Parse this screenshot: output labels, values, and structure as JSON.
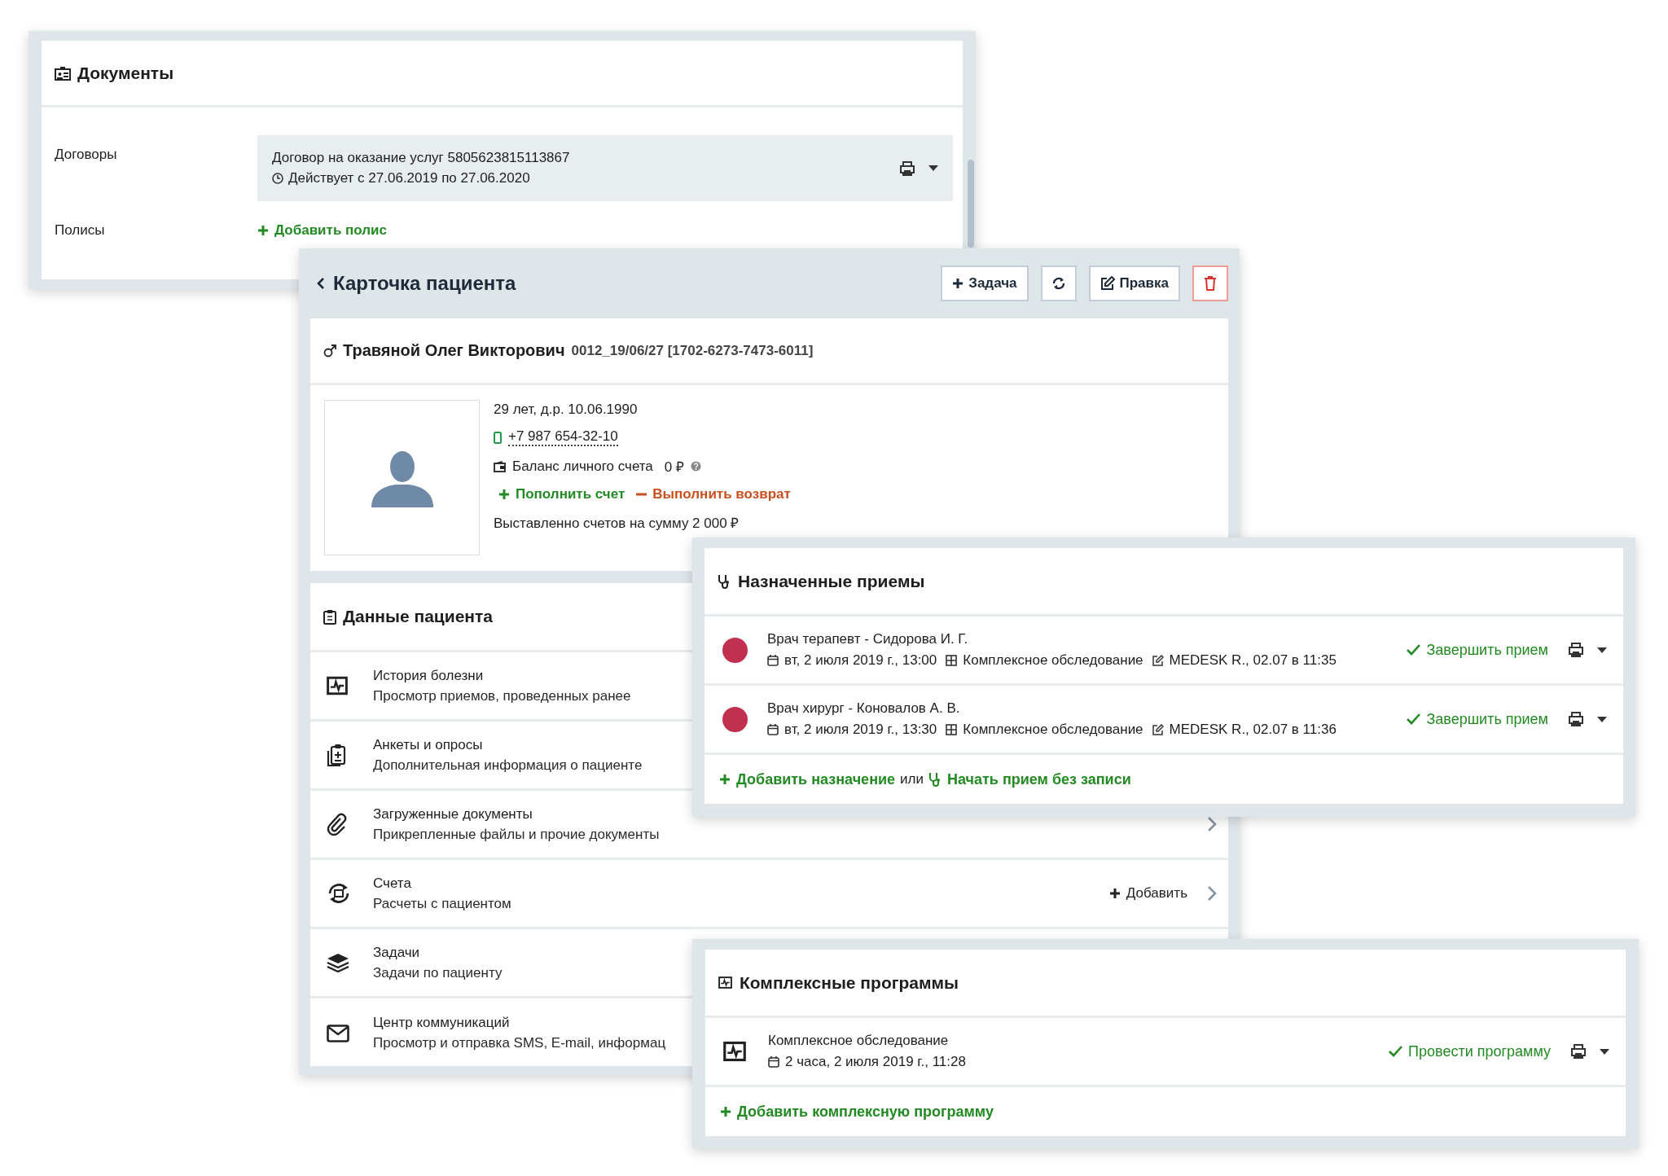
{
  "documents_panel": {
    "title": "Документы",
    "rows": [
      {
        "kind": "contract",
        "label": "Договоры",
        "contract_title": "Договор на оказание услуг 5805623815113867",
        "validity": "Действует с 27.06.2019 по 27.06.2020"
      },
      {
        "kind": "add",
        "label": "Полисы",
        "link": "Добавить полис"
      }
    ]
  },
  "patient_card": {
    "title": "Карточка пациента",
    "buttons": [
      {
        "kind": "task",
        "label": "Задача"
      },
      {
        "kind": "refresh"
      },
      {
        "kind": "edit",
        "label": "Правка"
      },
      {
        "kind": "delete"
      }
    ],
    "patient": {
      "name": "Травяной Олег Викторович",
      "record_id": "0012_19/06/27 [1702-6273-7473-6011]",
      "age_birth": "29 лет, д.р. 10.06.1990",
      "phone": "+7 987 654-32-10",
      "balance_label": "Баланс личного счета",
      "balance": "0 ₽",
      "top_up": "Пополнить счет",
      "refund": "Выполнить возврат",
      "invoiced": "Выставленно счетов на сумму 2 000 ₽"
    },
    "data_section": {
      "title": "Данные пациента",
      "items": [
        {
          "kind": "history",
          "title": "История болезни",
          "subtitle": "Просмотр приемов, проведенных ранее",
          "chevron": false
        },
        {
          "kind": "survey",
          "title": "Анкеты и опросы",
          "subtitle": "Дополнительная информация о пациенте",
          "chevron": false
        },
        {
          "kind": "documents",
          "title": "Загруженные документы",
          "subtitle": "Прикрепленные файлы и прочие документы",
          "chevron": true
        },
        {
          "kind": "invoices",
          "title": "Счета",
          "subtitle": "Расчеты с пациентом",
          "action": "Добавить",
          "chevron": true
        },
        {
          "kind": "tasks",
          "title": "Задачи",
          "subtitle": "Задачи по пациенту",
          "chevron": false
        },
        {
          "kind": "messages",
          "title": "Центр коммуникаций",
          "subtitle": "Просмотр и отправка SMS, E-mail, информац",
          "chevron": false
        }
      ]
    }
  },
  "appointments": {
    "title": "Назначенные приемы",
    "rows": [
      {
        "doctor": "Врач терапевт - Сидорова И. Г.",
        "date": "вт, 2 июля 2019 г., 13:00",
        "program": "Комплексное обследование",
        "edited": "MEDESK R., 02.07 в 11:35",
        "action": "Завершить прием"
      },
      {
        "doctor": "Врач хирург - Коновалов А. В.",
        "date": "вт, 2 июля 2019 г., 13:30",
        "program": "Комплексное обследование",
        "edited": "MEDESK R., 02.07 в 11:36",
        "action": "Завершить прием"
      }
    ],
    "add_link": "Добавить назначение",
    "or": "или",
    "walk_in_link": "Начать прием без записи"
  },
  "programs": {
    "title": "Комплексные программы",
    "rows": [
      {
        "name": "Комплексное обследование",
        "date": "2 часа, 2 июля 2019 г., 11:28",
        "action": "Провести программу"
      }
    ],
    "add_link": "Добавить комплексную программу"
  }
}
